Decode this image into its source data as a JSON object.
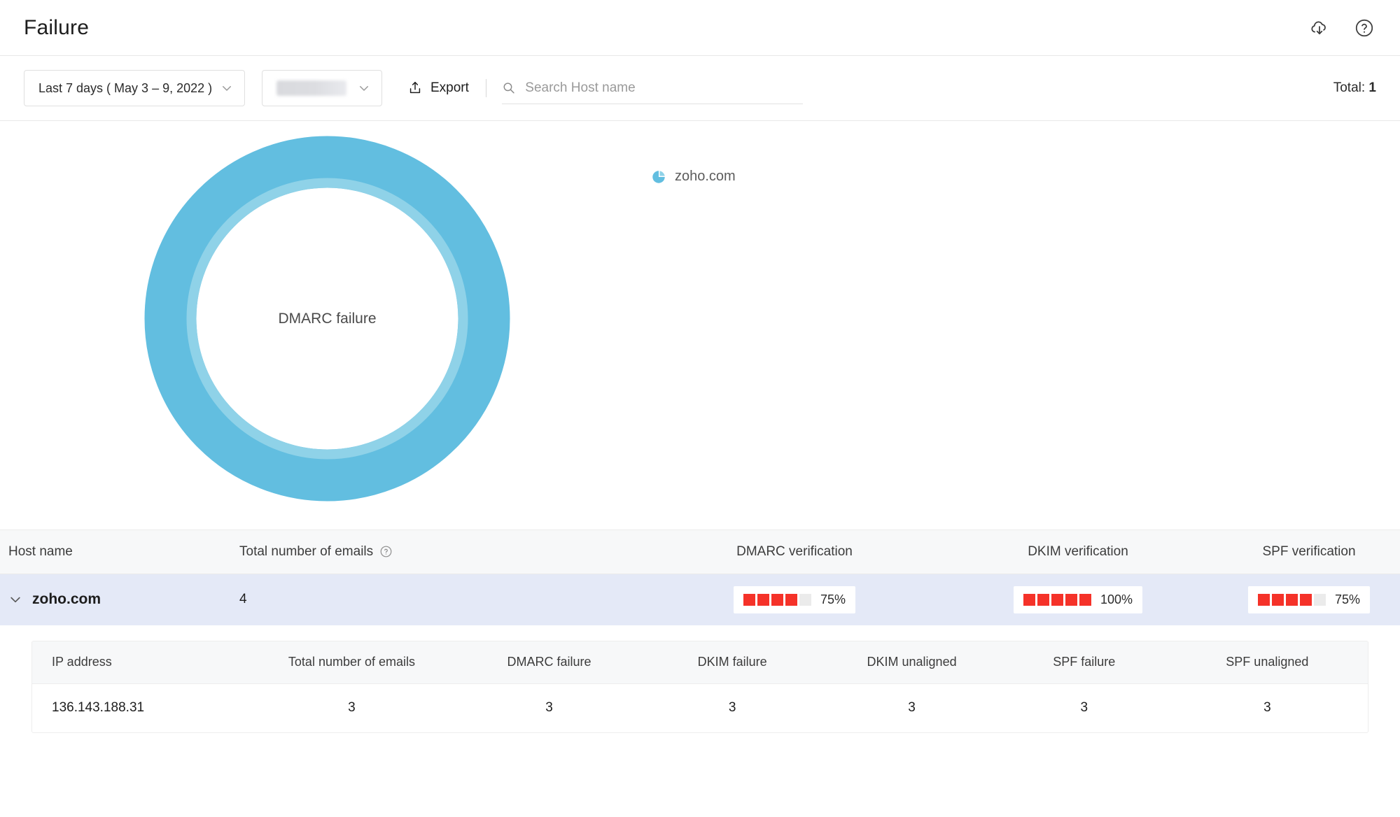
{
  "header": {
    "title": "Failure",
    "download_icon": "cloud-download-icon",
    "help_icon": "help-circle-icon"
  },
  "toolbar": {
    "date_range": "Last 7 days ( May 3 – 9, 2022 )",
    "account_value": "",
    "export_label": "Export",
    "search_placeholder": "Search Host name",
    "search_value": "",
    "total_label": "Total:",
    "total_value": "1"
  },
  "chart_data": {
    "type": "pie",
    "title": "",
    "center_label": "DMARC failure",
    "categories": [
      "zoho.com"
    ],
    "values": [
      100
    ],
    "colors": [
      "#62bee0"
    ],
    "inner_ring_color": "#8fd2e8",
    "legend": [
      {
        "label": "zoho.com",
        "color": "#62bee0"
      }
    ],
    "legend_position": "right",
    "donut": true
  },
  "table": {
    "columns": [
      "Host name",
      "Total number of emails",
      "DMARC verification",
      "DKIM verification",
      "SPF verification"
    ],
    "emails_help_icon": "help-circle-icon",
    "rows": [
      {
        "expand_icon": "chevron-down-icon",
        "host": "zoho.com",
        "emails": "4",
        "dmarc": {
          "percent_label": "75%",
          "filled": 4,
          "total": 5
        },
        "dkim": {
          "percent_label": "100%",
          "filled": 5,
          "total": 5
        },
        "spf": {
          "percent_label": "75%",
          "filled": 4,
          "total": 5
        }
      }
    ]
  },
  "subtable": {
    "columns": [
      "IP address",
      "Total number of emails",
      "DMARC failure",
      "DKIM failure",
      "DKIM unaligned",
      "SPF failure",
      "SPF unaligned"
    ],
    "rows": [
      {
        "ip": "136.143.188.31",
        "emails": "3",
        "dmarc_failure": "3",
        "dkim_failure": "3",
        "dkim_unaligned": "3",
        "spf_failure": "3",
        "spf_unaligned": "3"
      }
    ]
  },
  "colors": {
    "accent_blue": "#62bee0",
    "row_highlight": "#e4e9f7",
    "bar_red": "#f53229",
    "header_bg": "#f7f8f9"
  }
}
